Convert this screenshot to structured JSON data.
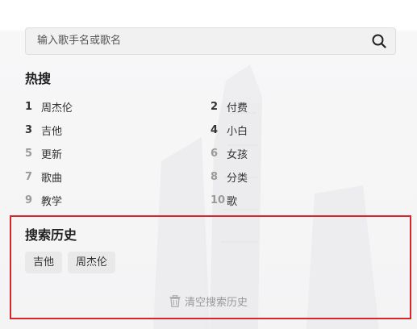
{
  "search": {
    "placeholder": "输入歌手名或歌名",
    "icon": "search-icon"
  },
  "hot": {
    "title": "热搜",
    "items": [
      {
        "rank": "1",
        "word": "周杰伦"
      },
      {
        "rank": "2",
        "word": "付费"
      },
      {
        "rank": "3",
        "word": "吉他"
      },
      {
        "rank": "4",
        "word": "小白"
      },
      {
        "rank": "5",
        "word": "更新"
      },
      {
        "rank": "6",
        "word": "女孩"
      },
      {
        "rank": "7",
        "word": "歌曲"
      },
      {
        "rank": "8",
        "word": "分类"
      },
      {
        "rank": "9",
        "word": "教学"
      },
      {
        "rank": "10",
        "word": "歌"
      }
    ]
  },
  "history": {
    "title": "搜索历史",
    "chips": [
      "吉他",
      "周杰伦"
    ],
    "clear_label": "清空搜索历史",
    "clear_icon": "trash-icon"
  },
  "colors": {
    "highlight_border": "#d9242a",
    "rank_top": "#333333",
    "rank_low": "#9a9a9a"
  }
}
